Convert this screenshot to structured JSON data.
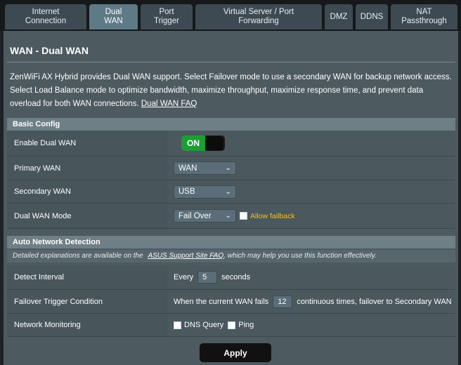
{
  "tabs": [
    {
      "label": "Internet\nConnection",
      "active": false
    },
    {
      "label": "Dual\nWAN",
      "active": true
    },
    {
      "label": "Port\nTrigger",
      "active": false
    },
    {
      "label": "Virtual Server / Port\nForwarding",
      "active": false
    },
    {
      "label": "DMZ",
      "active": false
    },
    {
      "label": "DDNS",
      "active": false
    },
    {
      "label": "NAT\nPassthrough",
      "active": false
    }
  ],
  "page": {
    "title": "WAN - Dual WAN",
    "description": "ZenWiFi AX Hybrid provides Dual WAN support. Select Failover mode to use a secondary WAN for backup network access. Select Load Balance mode to optimize bandwidth, maximize throughput, maximize response time, and prevent data overload for both WAN connections.",
    "faq_link": "Dual WAN FAQ"
  },
  "basic_config": {
    "header": "Basic Config",
    "enable_label": "Enable Dual WAN",
    "enable_state": "ON",
    "primary_label": "Primary WAN",
    "primary_value": "WAN",
    "secondary_label": "Secondary WAN",
    "secondary_value": "USB",
    "mode_label": "Dual WAN Mode",
    "mode_value": "Fail Over",
    "allow_failback": "Allow failback"
  },
  "auto_detect": {
    "header": "Auto Network Detection",
    "note_prefix": "Detailed explanations are available on the",
    "note_link": "ASUS Support Site FAQ",
    "note_suffix": ", which may help you use this function effectively.",
    "interval_label": "Detect Interval",
    "interval_prefix": "Every",
    "interval_value": "5",
    "interval_suffix": "seconds",
    "failover_label": "Failover Trigger Condition",
    "failover_prefix": "When the current WAN fails",
    "failover_value": "12",
    "failover_suffix": "continuous times, failover to Secondary WAN",
    "monitor_label": "Network Monitoring",
    "dns_query": "DNS Query",
    "ping": "Ping"
  },
  "actions": {
    "apply": "Apply"
  },
  "colors": {
    "accent_on": "#1c9e34",
    "allow_failback": "#f0c21b"
  }
}
